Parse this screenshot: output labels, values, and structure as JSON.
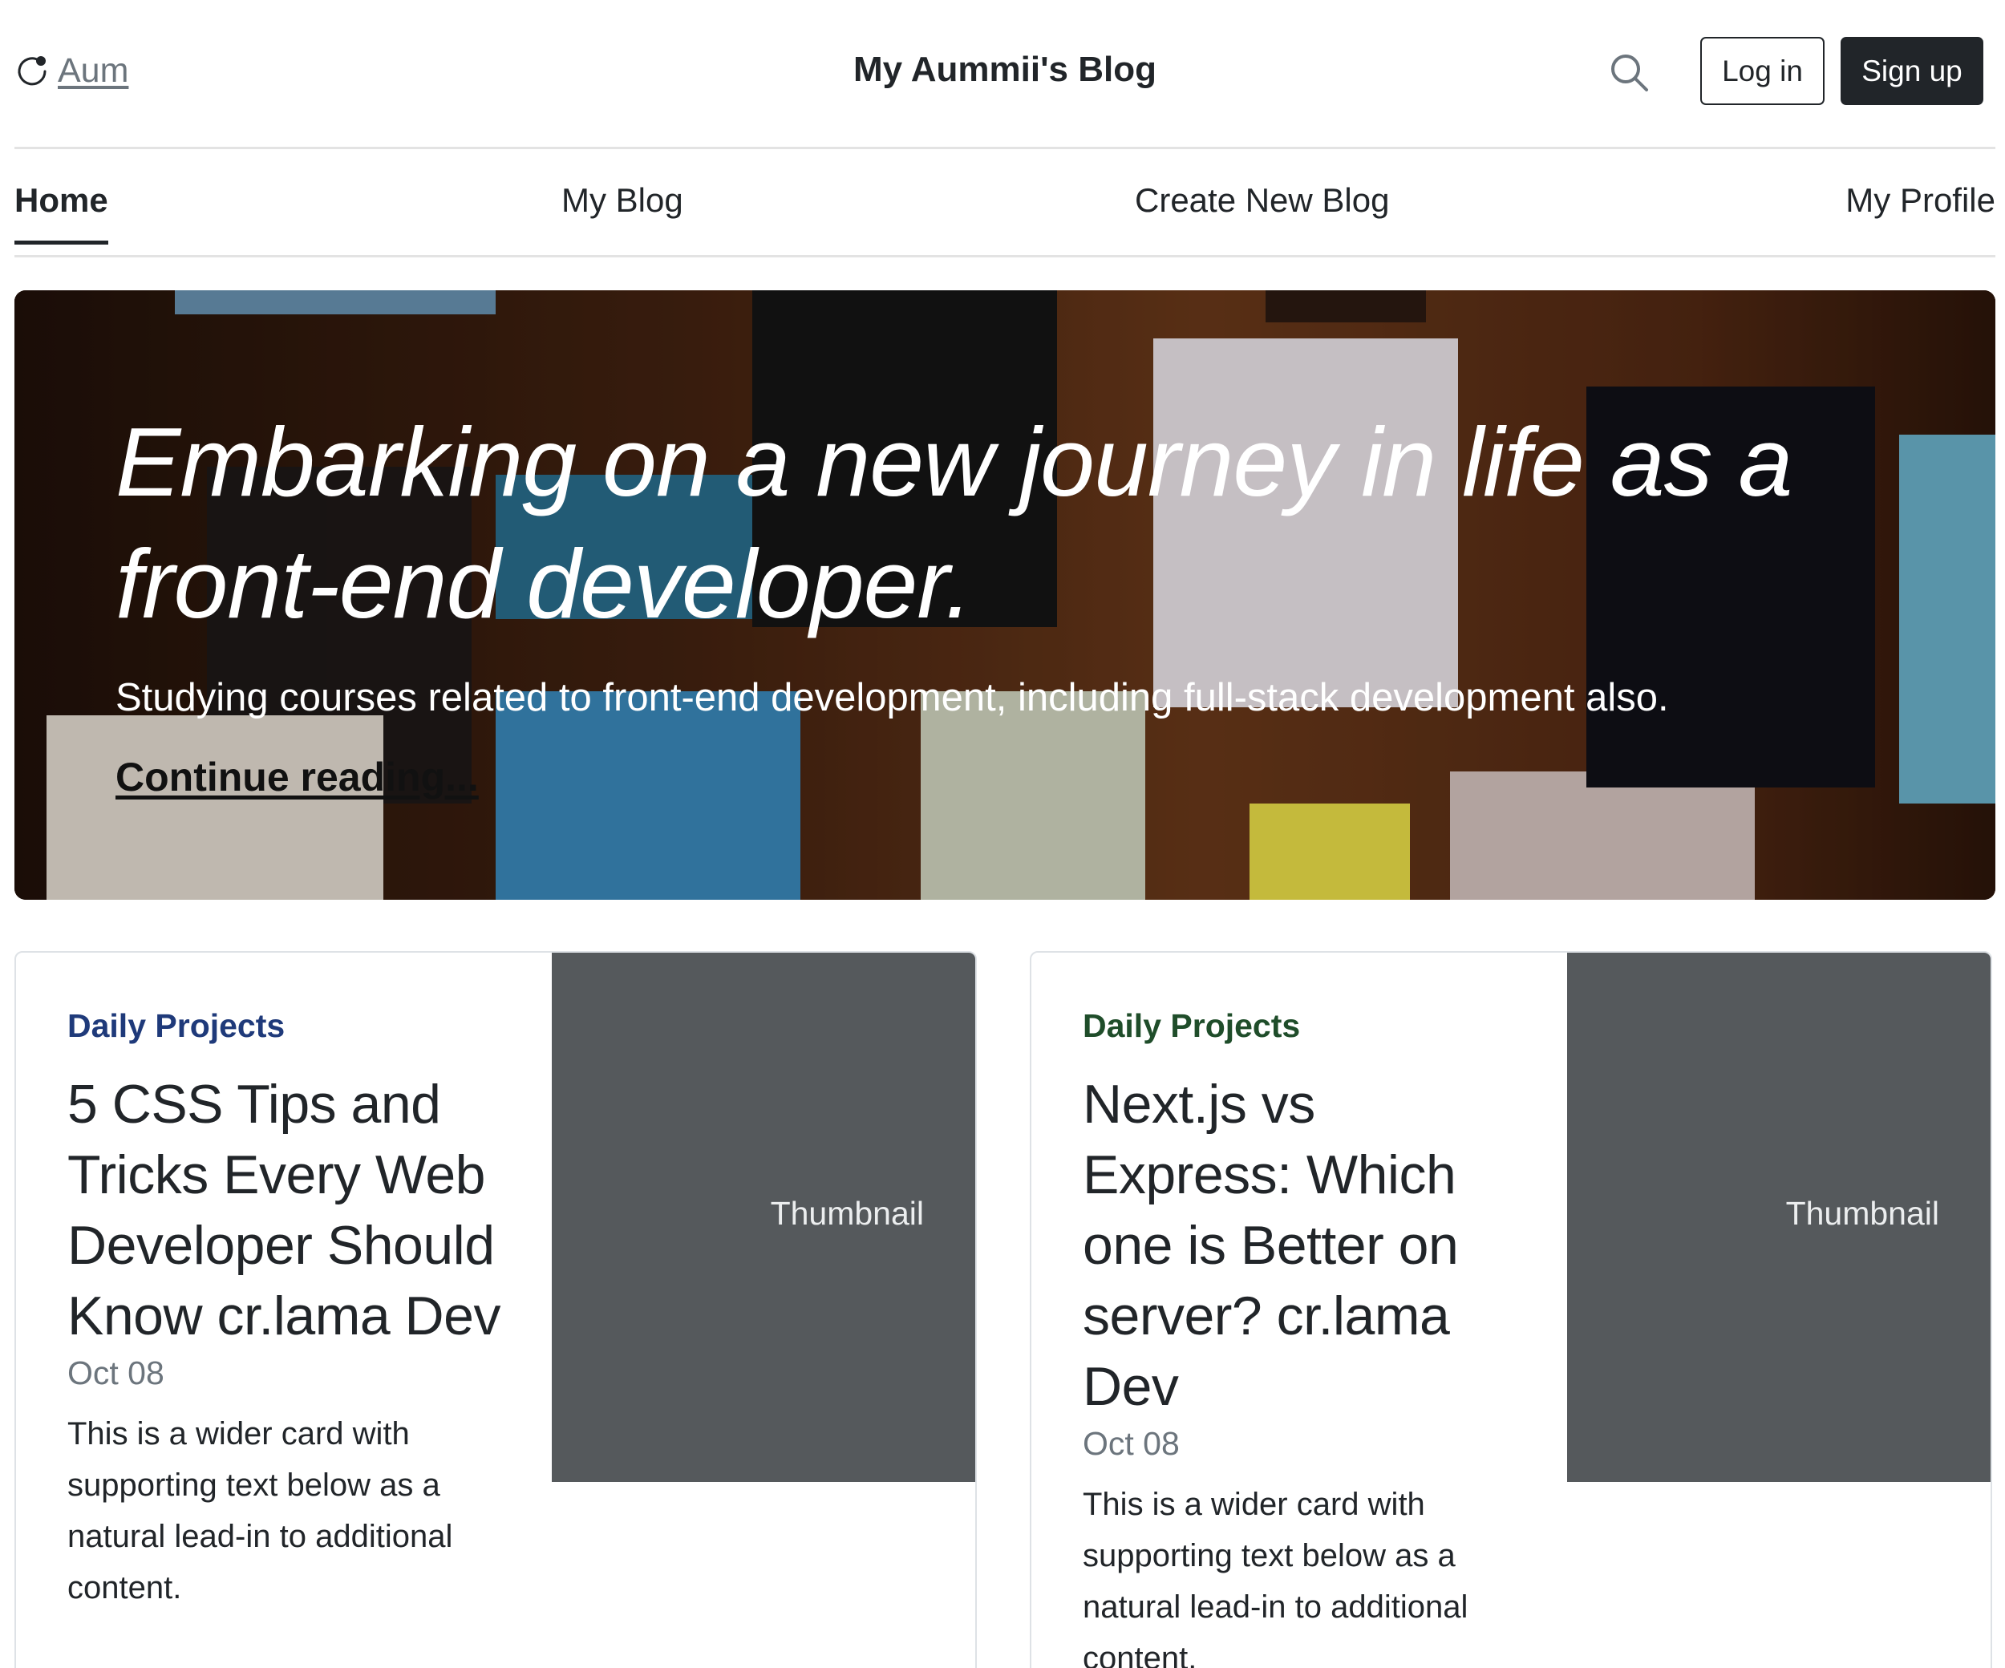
{
  "header": {
    "brand_text": "Aum",
    "site_title": "My Aummii's Blog",
    "login_label": "Log in",
    "signup_label": "Sign up"
  },
  "nav": {
    "items": [
      {
        "label": "Home",
        "active": true
      },
      {
        "label": "My Blog",
        "active": false
      },
      {
        "label": "Create New Blog",
        "active": false
      },
      {
        "label": "My Profile",
        "active": false
      }
    ]
  },
  "hero": {
    "title": "Embarking on a new journey in life as a front-end developer.",
    "lead": "Studying courses related to front-end development, including full-stack development also.",
    "link_label": "Continue reading..."
  },
  "cards": [
    {
      "category": "Daily Projects",
      "title": "5 CSS Tips and Tricks Every Web Developer Should Know cr.lama Dev",
      "date": "Oct 08",
      "text": "This is a wider card with supporting text below as a natural lead-in to additional content.",
      "thumbnail_label": "Thumbnail"
    },
    {
      "category": "Daily Projects",
      "title": "Next.js vs Express: Which one is Better on server? cr.lama Dev",
      "date": "Oct 08",
      "text": "This is a wider card with supporting text below as a natural lead-in to additional content.",
      "thumbnail_label": "Thumbnail"
    }
  ]
}
